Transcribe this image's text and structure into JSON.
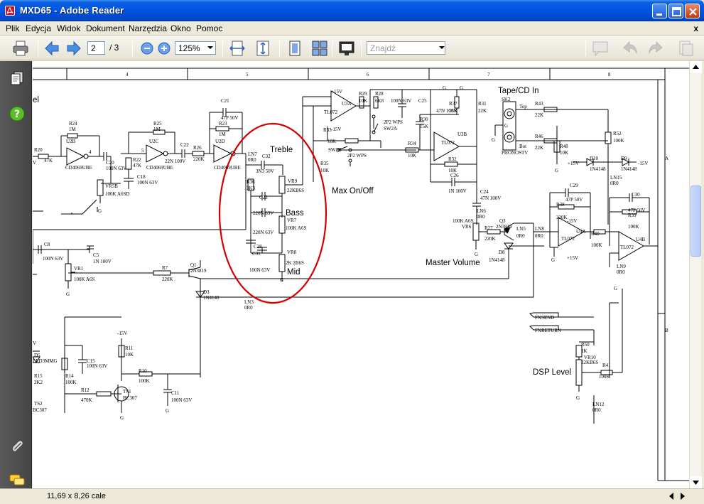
{
  "window": {
    "title": "MXD65 - Adobe Reader",
    "colors": {
      "titlebar": "#0054e3",
      "nav_panel": "#4f4f4f",
      "highlight_circle": "#d40000"
    }
  },
  "menu": {
    "items": [
      "Plik",
      "Edycja",
      "Widok",
      "Dokument",
      "Narzędzia",
      "Okno",
      "Pomoc"
    ],
    "close_glyph": "x"
  },
  "toolbar": {
    "page_current": "2",
    "page_total": "/ 3",
    "zoom": "125%",
    "find_placeholder": "Znajdź",
    "icons": [
      "print-icon",
      "prev-page-icon",
      "next-page-icon",
      "zoom-out-icon",
      "zoom-in-icon",
      "fit-width-icon",
      "fit-page-icon",
      "single-page-icon",
      "two-page-icon",
      "fullscreen-icon",
      "comment-icon",
      "undo-icon",
      "redo-icon",
      "export-icon"
    ]
  },
  "navpanel": {
    "icons": [
      "pages-icon",
      "help-icon",
      "attachment-icon",
      "comments-icon"
    ]
  },
  "status": {
    "page_size": "11,69 x 8,26 cale"
  },
  "schematic": {
    "column_numbers": [
      "4",
      "5",
      "6",
      "7",
      "8"
    ],
    "row_letters": [
      "A",
      "B"
    ],
    "labels": {
      "treble": "Treble",
      "bass": "Bass",
      "mid": "Mid",
      "max_on_off": "Max On/Off",
      "tape_cd_in": "Tape/CD In",
      "master_volume": "Master Volume",
      "dsp_level": "DSP Level",
      "cut_el": "el"
    },
    "components": {
      "r24": "R24",
      "r24v": "1M",
      "u2b": "U2B",
      "u2b_part": "CD4069UBE",
      "u2b_pin": "4",
      "r20": "R20",
      "r20v": "47K",
      "c20": "C20",
      "c20v": "100N 63V",
      "vr5b": "VR5B",
      "vr5bv": "100K A6SD",
      "r25": "R25",
      "r25v": "1M",
      "u2c": "U2C",
      "u2c_part": "CD4069UBE",
      "u2c_pin": "5",
      "r22": "R22",
      "r22v": "47K",
      "c18": "C18",
      "c18v": "100N 63V",
      "c22": "C22",
      "c22v": "22N 100V",
      "r26": "R26",
      "r26v": "220K",
      "c21": "C21",
      "c21v": "47P 50V",
      "r23": "R23",
      "r23v": "1M",
      "u2d": "U2D",
      "u2d_part": "CD4069UBE",
      "ln7": "LN7",
      "ln7v": "0R0",
      "c32": "C32",
      "c32v": "3N3 50V",
      "vr9": "VR9",
      "vr9v": "22KB6S",
      "r36": "R36",
      "r36v": "3K3",
      "c23": "C23",
      "c23v": "220N 63V",
      "vr7": "VR7",
      "vr7v": "100K A6S",
      "c27v": "220N 63V",
      "c28": "C28",
      "c31": "C31",
      "c31v": "100N 63V",
      "vr8": "VR8",
      "vr8v": "2K 2B6S",
      "u3a": "U3A",
      "tl072": "TL072",
      "p15v": "+15V",
      "m15v": "-15V",
      "r29": "R29",
      "r29v": "10K",
      "r28": "R28",
      "r28v": "6K8",
      "c25": "C25",
      "c25v": "100N 63V",
      "r37": "R37",
      "r37v": "15K",
      "c33v": "47N 100V",
      "r31": "R31",
      "r31v": "22K",
      "sw2a": "SW2A",
      "sw2av": "2P2 WPS",
      "r30": "R30",
      "r30v": "15K",
      "r33": "R33",
      "r33v": "10K",
      "u3b": "U3B",
      "sw2b": "SW2B",
      "sw2bv": "2P2 WPS",
      "r34": "R34",
      "r34v": "10K",
      "r35": "R35",
      "r35v": "10K",
      "r32": "R32",
      "r32v": "10K",
      "c26": "C26",
      "c26v": "1N 100V",
      "c24": "C24",
      "c24v": "47N 100V",
      "sk2": "SK2",
      "top": "Top",
      "bot": "Bot",
      "phonostv": "PHONOSTV",
      "r43": "R43",
      "r43v": "22K",
      "r46": "R46",
      "r46v": "22K",
      "r48": "R48",
      "r48v": "10K",
      "r52": "R52",
      "r52v": "100K",
      "d10": "D10",
      "d10v": "1N4148",
      "d9": "D9",
      "d9v": "1N4148",
      "ln15": "LN15",
      "ln15v": "0R0",
      "c29": "C29",
      "c29v": "47P 50V",
      "r38": "R38",
      "r38v": "220K",
      "u4a": "U4A",
      "r40": "R40",
      "r40v": "100K",
      "c30": "C30",
      "c30v": "47P 50V",
      "r39": "R39",
      "r39v": "100K",
      "u4b": "U4B",
      "ln6": "LN6",
      "ln6v": "0R0",
      "vr6": "VR6",
      "vr6v": "100K A6S",
      "r27": "R27",
      "r27v": "220K",
      "q3": "Q3",
      "q3v": "2N3819",
      "ln5": "LN5",
      "ln5v": "0R0",
      "ln8": "LN8",
      "ln8v": "0R0",
      "d8": "D8",
      "d8v": "1N4148",
      "ln9": "LN9",
      "ln9v": "0R0",
      "c8": "C8",
      "c8v": "100N 63V",
      "c5": "C5",
      "c5v": "1N 100V",
      "vr1": "VR1",
      "vr1v": "100K A6S",
      "r7": "R7",
      "r7v": "220K",
      "q1": "Q1",
      "q1v": "2N3819",
      "d3": "D3",
      "d3v": "1N4148",
      "ln3": "LN3",
      "ln3v": "0R0",
      "fxsend": "FXSEND",
      "fxreturn": "FXRETURN",
      "r50": "R50",
      "r50v": "1K",
      "vr10": "VR10",
      "vr10v": "22KB6S",
      "r41": "R41",
      "r41v": "100K",
      "ln12": "LN12",
      "ln12v": "0R0",
      "d5": "D5",
      "d5v": "LED3MMG",
      "c15": "C15",
      "c15v": "100N 63V",
      "r15": "R15",
      "r15v": "2K2",
      "r14": "R14",
      "r14v": "100K",
      "r11": "R11",
      "r11v": "10K",
      "r10": "R10",
      "r10v": "100K",
      "r12": "R12",
      "r12v": "470K",
      "ts1": "TS1",
      "ts1v": "BC307",
      "ts2": "TS2",
      "ts2v": "BC307",
      "c11": "C11",
      "c11v": "100N 63V",
      "g": "G",
      "v": "V"
    }
  }
}
